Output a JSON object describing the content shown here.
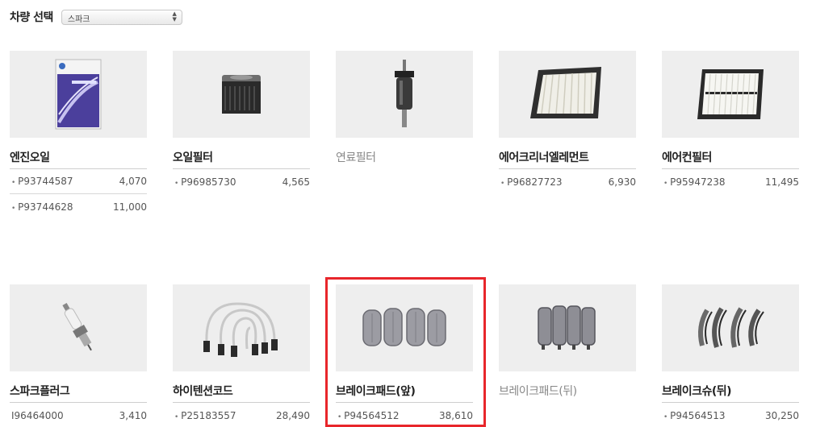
{
  "header": {
    "vehicle_label": "차량 선택",
    "vehicle_select_value": "스파크"
  },
  "products": [
    {
      "name": "엔진오일",
      "icon": "engine-oil-box",
      "parts": [
        {
          "code": "P93744587",
          "price": "4,070"
        },
        {
          "code": "P93744628",
          "price": "11,000"
        }
      ]
    },
    {
      "name": "오일필터",
      "icon": "oil-filter",
      "parts": [
        {
          "code": "P96985730",
          "price": "4,565"
        }
      ]
    },
    {
      "name": "연료필터",
      "icon": "fuel-filter",
      "parts": []
    },
    {
      "name": "에어크리너엘레먼트",
      "icon": "air-cleaner-element",
      "parts": [
        {
          "code": "P96827723",
          "price": "6,930"
        }
      ]
    },
    {
      "name": "에어컨필터",
      "icon": "cabin-air-filter",
      "parts": [
        {
          "code": "P95947238",
          "price": "11,495"
        }
      ]
    },
    {
      "name": "스파크플러그",
      "icon": "spark-plug",
      "parts": [
        {
          "code": "I96464000",
          "price": "3,410"
        }
      ]
    },
    {
      "name": "하이텐션코드",
      "icon": "high-tension-cord",
      "parts": [
        {
          "code": "P25183557",
          "price": "28,490"
        }
      ]
    },
    {
      "name": "브레이크패드(앞)",
      "icon": "front-brake-pads",
      "parts": [
        {
          "code": "P94564512",
          "price": "38,610"
        }
      ]
    },
    {
      "name": "브레이크패드(뒤)",
      "icon": "rear-brake-pads",
      "parts": []
    },
    {
      "name": "브레이크슈(뒤)",
      "icon": "brake-shoes",
      "parts": [
        {
          "code": "P94564513",
          "price": "30,250"
        }
      ]
    }
  ],
  "colors": {
    "highlight": "#e8262b",
    "thumb_bg": "#eeeeee"
  }
}
